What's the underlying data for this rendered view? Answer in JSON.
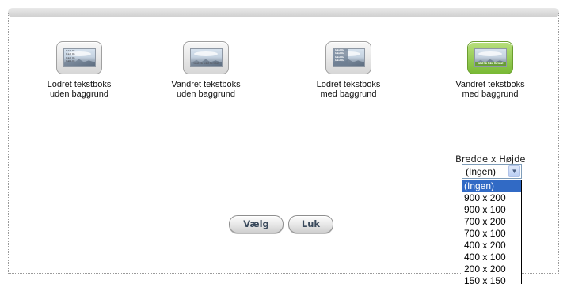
{
  "options": [
    {
      "label_line1": "Lodret tekstboks",
      "label_line2": "uden baggrund",
      "thumb_text": [
        "tekst tle",
        "tekst tle",
        "tekst tle",
        "tekst tle"
      ],
      "selected": false
    },
    {
      "label_line1": "Vandret tekstboks",
      "label_line2": "uden baggrund",
      "thumb_text": "tekst tle  tekst tle  tekst",
      "selected": false
    },
    {
      "label_line1": "Lodret tekstboks",
      "label_line2": "med baggrund",
      "thumb_text": [
        "tekst tle",
        "tekst tle",
        "tekst tle",
        "tekst tle"
      ],
      "selected": false
    },
    {
      "label_line1": "Vandret tekstboks",
      "label_line2": "med baggrund",
      "thumb_text": "tekst tle  tekst tle  tekst",
      "selected": true
    }
  ],
  "size": {
    "label": "Bredde x Højde",
    "selected": "(Ingen)",
    "options": [
      "(Ingen)",
      "900 x 200",
      "900 x 100",
      "700 x 200",
      "700 x 100",
      "400 x 200",
      "400 x 100",
      "200 x 200",
      "150 x 150"
    ],
    "highlighted_index": 0
  },
  "buttons": {
    "select_label": "Vælg",
    "close_label": "Luk"
  },
  "colors": {
    "selected_thumb": "#78b934",
    "dropdown_highlight": "#316ac5"
  }
}
